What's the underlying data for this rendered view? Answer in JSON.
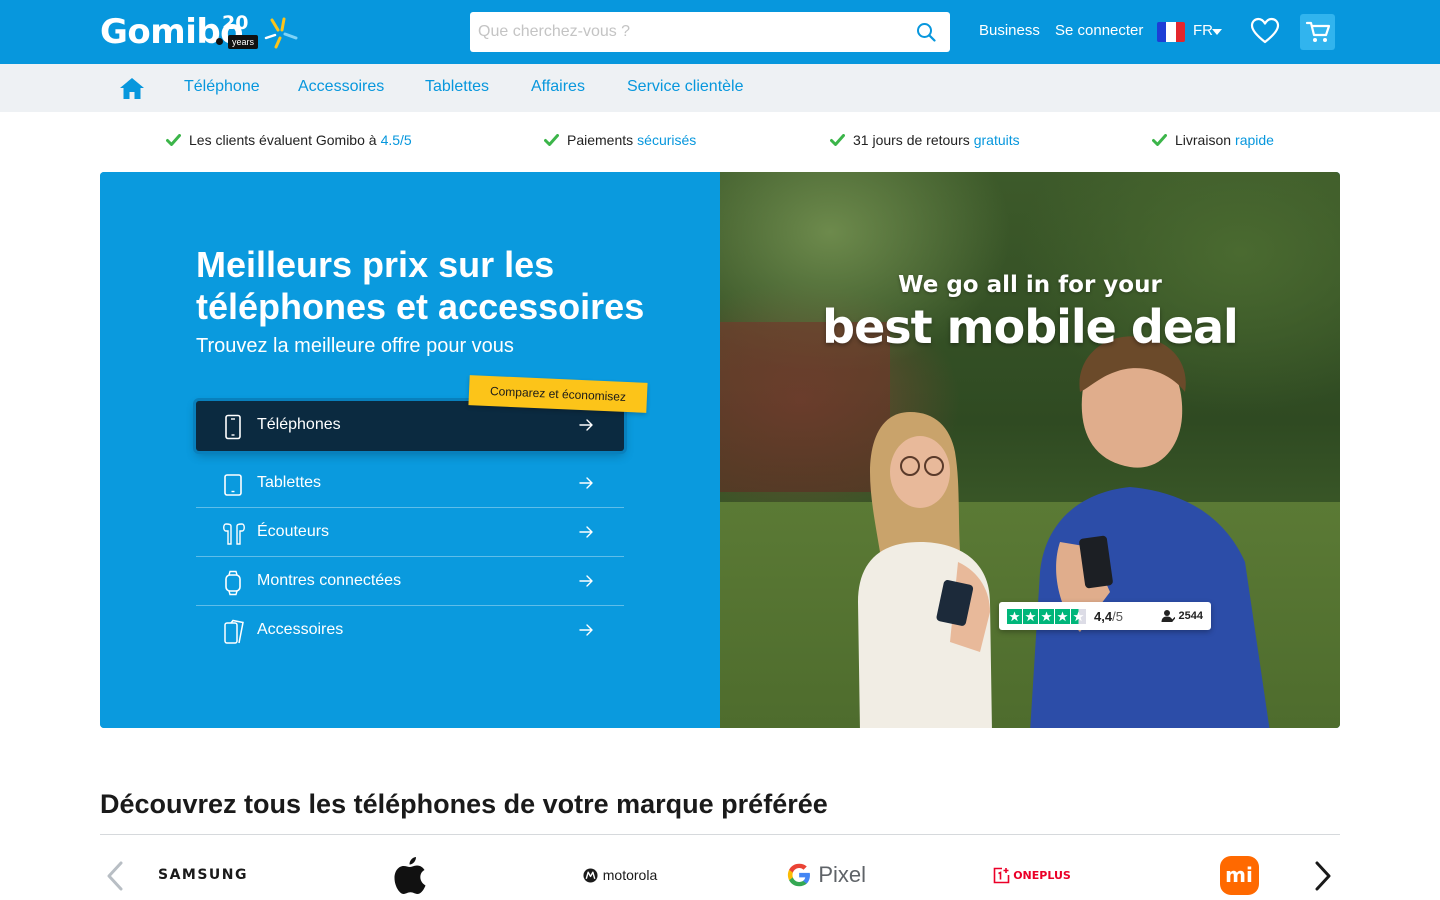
{
  "header": {
    "logo_text": "Gomibo",
    "logo_badge_number": "20",
    "logo_badge_word": "years",
    "search_placeholder": "Que cherchez-vous ?",
    "links": {
      "business": "Business",
      "login": "Se connecter"
    },
    "language": "FR"
  },
  "nav": {
    "items": [
      "Téléphone",
      "Accessoires",
      "Tablettes",
      "Affaires",
      "Service clientèle"
    ]
  },
  "usps": [
    {
      "text": "Les clients évaluent Gomibo à",
      "highlight": "4.5/5"
    },
    {
      "text": "Paiements",
      "highlight": "sécurisés"
    },
    {
      "text": "31 jours de retours",
      "highlight": "gratuits"
    },
    {
      "text": "Livraison",
      "highlight": "rapide"
    }
  ],
  "hero": {
    "title": "Meilleurs prix sur les téléphones et accessoires",
    "subtitle": "Trouvez la meilleure offre pour vous",
    "badge": "Comparez et économisez",
    "categories": [
      "Téléphones",
      "Tablettes",
      "Écouteurs",
      "Montres connectées",
      "Accessoires"
    ],
    "promo_line1": "We go all in for your",
    "promo_line2": "best mobile deal",
    "rating": {
      "score": "4,4",
      "of": "/5",
      "reviews": "2544",
      "stars": 4.5
    }
  },
  "brands": {
    "title": "Découvrez tous les téléphones de votre marque préférée",
    "items": [
      "SAMSUNG",
      "Apple",
      "motorola",
      "Pixel",
      "ONEPLUS",
      "mi"
    ]
  },
  "colors": {
    "primary": "#0797dd",
    "nav_bg": "#eef1f4",
    "active_category": "#0b2a40",
    "badge": "#fcc419",
    "check": "#3cb54a",
    "trustpilot": "#00b67a",
    "oneplus": "#eb0028",
    "xiaomi": "#ff6900"
  }
}
